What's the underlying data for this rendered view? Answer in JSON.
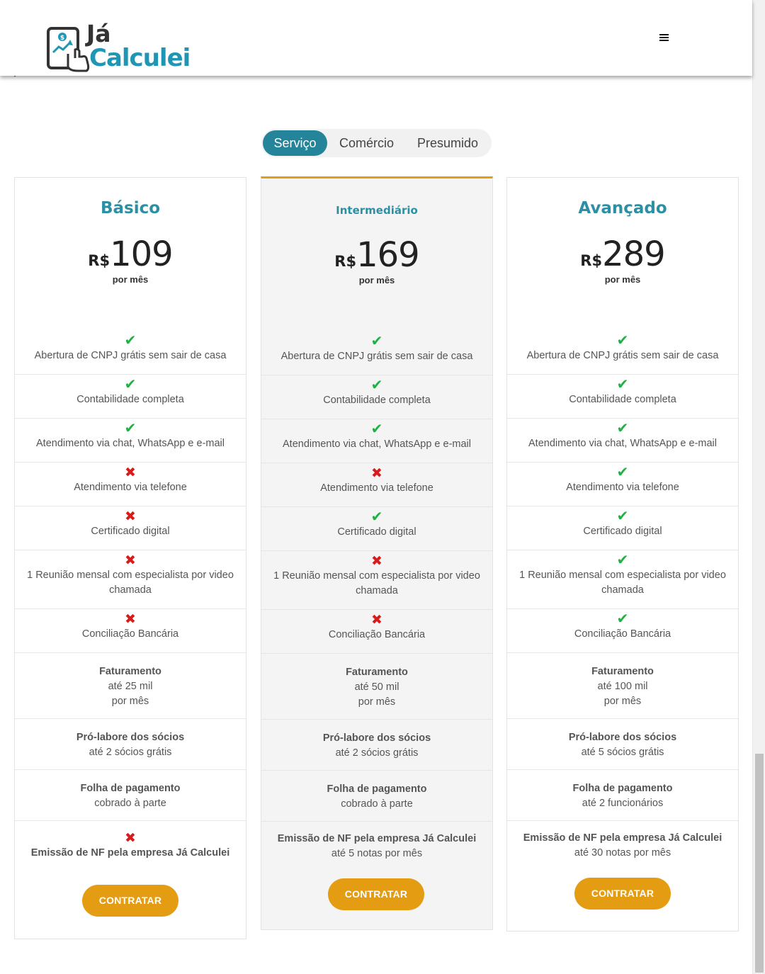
{
  "header": {
    "logo_top": "Já",
    "logo_bottom": "Calculei",
    "menu_icon": "hamburger-icon"
  },
  "tabs": [
    {
      "label": "Serviço",
      "active": true
    },
    {
      "label": "Comércio",
      "active": false
    },
    {
      "label": "Presumido",
      "active": false
    }
  ],
  "colors": {
    "accent": "#24849a",
    "plan_title": "#2d8fa3",
    "button": "#e49c13",
    "check": "#1fb144",
    "cross": "#d81c1c"
  },
  "plans": [
    {
      "name": "Básico",
      "currency": "R$",
      "price": "109",
      "period": "por mês",
      "features": [
        {
          "label": "Abertura de CNPJ grátis sem sair de casa",
          "included": true,
          "icon": "✔"
        },
        {
          "label": "Contabilidade completa",
          "included": true,
          "icon": "✔"
        },
        {
          "label": "Atendimento via chat, WhatsApp e e-mail",
          "included": true,
          "icon": "✔"
        },
        {
          "label": "Atendimento via telefone",
          "included": false,
          "icon": "✖"
        },
        {
          "label": "Certificado digital",
          "included": false,
          "icon": "✖"
        },
        {
          "label": "1 Reunião mensal com especialista por video chamada",
          "included": false,
          "icon": "✖"
        },
        {
          "label": "Conciliação Bancária",
          "included": false,
          "icon": "✖"
        }
      ],
      "faturamento": {
        "title": "Faturamento",
        "line1": "até 25 mil",
        "line2": "por mês"
      },
      "prolabore": {
        "title": "Pró-labore dos sócios",
        "value": "até 2 sócios grátis"
      },
      "folha": {
        "title": "Folha de pagamento",
        "value": "cobrado à parte"
      },
      "nf": {
        "title": "Emissão de NF pela empresa Já Calculei",
        "value": "",
        "icon": "✖"
      },
      "button": "CONTRATAR"
    },
    {
      "name": "Intermediário",
      "currency": "R$",
      "price": "169",
      "period": "por mês",
      "features": [
        {
          "label": "Abertura de CNPJ grátis sem sair de casa",
          "included": true,
          "icon": "✔"
        },
        {
          "label": "Contabilidade completa",
          "included": true,
          "icon": "✔"
        },
        {
          "label": "Atendimento via chat, WhatsApp e e-mail",
          "included": true,
          "icon": "✔"
        },
        {
          "label": "Atendimento via telefone",
          "included": false,
          "icon": "✖"
        },
        {
          "label": "Certificado digital",
          "included": true,
          "icon": "✔"
        },
        {
          "label": "1 Reunião mensal com especialista por video chamada",
          "included": false,
          "icon": "✖"
        },
        {
          "label": "Conciliação Bancária",
          "included": false,
          "icon": "✖"
        }
      ],
      "faturamento": {
        "title": "Faturamento",
        "line1": "até 50 mil",
        "line2": "por mês"
      },
      "prolabore": {
        "title": "Pró-labore dos sócios",
        "value": "até 2 sócios grátis"
      },
      "folha": {
        "title": "Folha de pagamento",
        "value": "cobrado à parte"
      },
      "nf": {
        "title": "Emissão de NF pela empresa Já Calculei",
        "value": "até 5 notas por mês"
      },
      "button": "CONTRATAR"
    },
    {
      "name": "Avançado",
      "currency": "R$",
      "price": "289",
      "period": "por mês",
      "features": [
        {
          "label": "Abertura de CNPJ grátis sem sair de casa",
          "included": true,
          "icon": "✔"
        },
        {
          "label": "Contabilidade completa",
          "included": true,
          "icon": "✔"
        },
        {
          "label": "Atendimento via chat, WhatsApp e e-mail",
          "included": true,
          "icon": "✔"
        },
        {
          "label": "Atendimento via telefone",
          "included": true,
          "icon": "✔"
        },
        {
          "label": "Certificado digital",
          "included": true,
          "icon": "✔"
        },
        {
          "label": "1 Reunião mensal com especialista por video chamada",
          "included": true,
          "icon": "✔"
        },
        {
          "label": "Conciliação Bancária",
          "included": true,
          "icon": "✔"
        }
      ],
      "faturamento": {
        "title": "Faturamento",
        "line1": "até 100 mil",
        "line2": "por mês"
      },
      "prolabore": {
        "title": "Pró-labore dos sócios",
        "value": "até 5 sócios grátis"
      },
      "folha": {
        "title": "Folha de pagamento",
        "value": "até 2 funcionários"
      },
      "nf": {
        "title": "Emissão de NF pela empresa Já Calculei",
        "value": "até 30 notas por mês"
      },
      "button": "CONTRATAR"
    }
  ]
}
